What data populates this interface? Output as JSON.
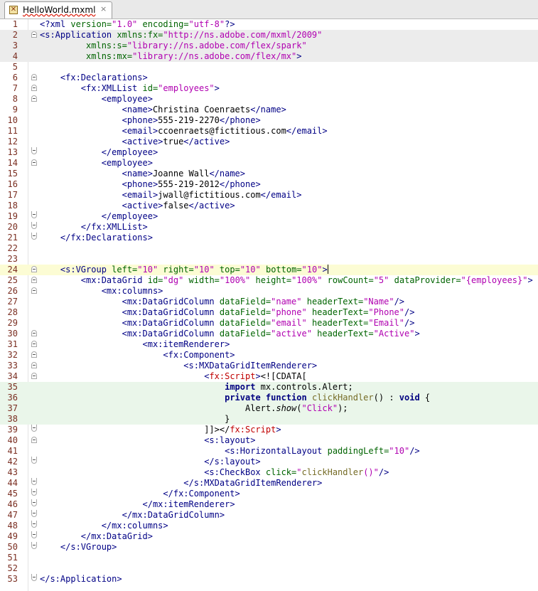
{
  "tab": {
    "label": "HelloWorld.mxml",
    "close": "×",
    "icon": "mxml-file-icon"
  },
  "lines": [
    {
      "n": "1",
      "bg": "",
      "fold": "",
      "segs": [
        [
          "t",
          "<?xml "
        ],
        [
          "a",
          "version="
        ],
        [
          "s",
          "\"1.0\""
        ],
        [
          "t",
          " "
        ],
        [
          "a",
          "encoding="
        ],
        [
          "s",
          "\"utf-8\""
        ],
        [
          "t",
          "?>"
        ]
      ]
    },
    {
      "n": "2",
      "bg": "app",
      "fold": "start",
      "segs": [
        [
          "t",
          "<s:Application "
        ],
        [
          "a",
          "xmlns:fx="
        ],
        [
          "s",
          "\"http://ns.adobe.com/mxml/2009\""
        ]
      ]
    },
    {
      "n": "3",
      "bg": "app",
      "fold": "",
      "segs": [
        [
          "",
          "         "
        ],
        [
          "a",
          "xmlns:s="
        ],
        [
          "s",
          "\"library://ns.adobe.com/flex/spark\""
        ]
      ]
    },
    {
      "n": "4",
      "bg": "app",
      "fold": "",
      "segs": [
        [
          "",
          "         "
        ],
        [
          "a",
          "xmlns:mx="
        ],
        [
          "s",
          "\"library://ns.adobe.com/flex/mx\""
        ],
        [
          "t",
          ">"
        ]
      ]
    },
    {
      "n": "5",
      "bg": "",
      "fold": "",
      "segs": []
    },
    {
      "n": "6",
      "bg": "",
      "fold": "start",
      "segs": [
        [
          "",
          "    "
        ],
        [
          "t",
          "<fx:Declarations>"
        ]
      ]
    },
    {
      "n": "7",
      "bg": "",
      "fold": "start",
      "segs": [
        [
          "",
          "        "
        ],
        [
          "t",
          "<fx:XMLList "
        ],
        [
          "a",
          "id="
        ],
        [
          "s",
          "\"employees\""
        ],
        [
          "t",
          ">"
        ]
      ]
    },
    {
      "n": "8",
      "bg": "",
      "fold": "start",
      "segs": [
        [
          "",
          "            "
        ],
        [
          "t",
          "<employee>"
        ]
      ]
    },
    {
      "n": "9",
      "bg": "",
      "fold": "",
      "segs": [
        [
          "",
          "                "
        ],
        [
          "t",
          "<name>"
        ],
        [
          "",
          "Christina Coenraets"
        ],
        [
          "t",
          "</name>"
        ]
      ]
    },
    {
      "n": "10",
      "bg": "",
      "fold": "",
      "segs": [
        [
          "",
          "                "
        ],
        [
          "t",
          "<phone>"
        ],
        [
          "",
          "555-219-2270"
        ],
        [
          "t",
          "</phone>"
        ]
      ]
    },
    {
      "n": "11",
      "bg": "",
      "fold": "",
      "segs": [
        [
          "",
          "                "
        ],
        [
          "t",
          "<email>"
        ],
        [
          "",
          "ccoenraets@fictitious.com"
        ],
        [
          "t",
          "</email>"
        ]
      ]
    },
    {
      "n": "12",
      "bg": "",
      "fold": "",
      "segs": [
        [
          "",
          "                "
        ],
        [
          "t",
          "<active>"
        ],
        [
          "",
          "true"
        ],
        [
          "t",
          "</active>"
        ]
      ]
    },
    {
      "n": "13",
      "bg": "",
      "fold": "end",
      "segs": [
        [
          "",
          "            "
        ],
        [
          "t",
          "</employee>"
        ]
      ]
    },
    {
      "n": "14",
      "bg": "",
      "fold": "start",
      "segs": [
        [
          "",
          "            "
        ],
        [
          "t",
          "<employee>"
        ]
      ]
    },
    {
      "n": "15",
      "bg": "",
      "fold": "",
      "segs": [
        [
          "",
          "                "
        ],
        [
          "t",
          "<name>"
        ],
        [
          "",
          "Joanne Wall"
        ],
        [
          "t",
          "</name>"
        ]
      ]
    },
    {
      "n": "16",
      "bg": "",
      "fold": "",
      "segs": [
        [
          "",
          "                "
        ],
        [
          "t",
          "<phone>"
        ],
        [
          "",
          "555-219-2012"
        ],
        [
          "t",
          "</phone>"
        ]
      ]
    },
    {
      "n": "17",
      "bg": "",
      "fold": "",
      "segs": [
        [
          "",
          "                "
        ],
        [
          "t",
          "<email>"
        ],
        [
          "",
          "jwall@fictitious.com"
        ],
        [
          "t",
          "</email>"
        ]
      ]
    },
    {
      "n": "18",
      "bg": "",
      "fold": "",
      "segs": [
        [
          "",
          "                "
        ],
        [
          "t",
          "<active>"
        ],
        [
          "",
          "false"
        ],
        [
          "t",
          "</active>"
        ]
      ]
    },
    {
      "n": "19",
      "bg": "",
      "fold": "end",
      "segs": [
        [
          "",
          "            "
        ],
        [
          "t",
          "</employee>"
        ]
      ]
    },
    {
      "n": "20",
      "bg": "",
      "fold": "end",
      "segs": [
        [
          "",
          "        "
        ],
        [
          "t",
          "</fx:XMLList>"
        ]
      ]
    },
    {
      "n": "21",
      "bg": "",
      "fold": "end",
      "segs": [
        [
          "",
          "    "
        ],
        [
          "t",
          "</fx:Declarations>"
        ]
      ]
    },
    {
      "n": "22",
      "bg": "",
      "fold": "",
      "segs": []
    },
    {
      "n": "23",
      "bg": "",
      "fold": "",
      "segs": []
    },
    {
      "n": "24",
      "bg": "cur",
      "fold": "start",
      "segs": [
        [
          "",
          "    "
        ],
        [
          "t",
          "<s:VGroup "
        ],
        [
          "a",
          "left="
        ],
        [
          "s",
          "\"10\""
        ],
        [
          "t",
          " "
        ],
        [
          "a",
          "right="
        ],
        [
          "s",
          "\"10\""
        ],
        [
          "t",
          " "
        ],
        [
          "a",
          "top="
        ],
        [
          "s",
          "\"10\""
        ],
        [
          "t",
          " "
        ],
        [
          "a",
          "bottom="
        ],
        [
          "s",
          "\"10\""
        ],
        [
          "t",
          ">"
        ],
        [
          "caret",
          ""
        ]
      ]
    },
    {
      "n": "25",
      "bg": "",
      "fold": "start",
      "segs": [
        [
          "",
          "        "
        ],
        [
          "t",
          "<mx:DataGrid "
        ],
        [
          "a",
          "id="
        ],
        [
          "s",
          "\"dg\""
        ],
        [
          "t",
          " "
        ],
        [
          "a",
          "width="
        ],
        [
          "s",
          "\"100%\""
        ],
        [
          "t",
          " "
        ],
        [
          "a",
          "height="
        ],
        [
          "s",
          "\"100%\""
        ],
        [
          "t",
          " "
        ],
        [
          "a",
          "rowCount="
        ],
        [
          "s",
          "\"5\""
        ],
        [
          "t",
          " "
        ],
        [
          "a",
          "dataProvider="
        ],
        [
          "s",
          "\"{employees}\""
        ],
        [
          "t",
          ">"
        ]
      ]
    },
    {
      "n": "26",
      "bg": "",
      "fold": "start",
      "segs": [
        [
          "",
          "            "
        ],
        [
          "t",
          "<mx:columns>"
        ]
      ]
    },
    {
      "n": "27",
      "bg": "",
      "fold": "",
      "segs": [
        [
          "",
          "                "
        ],
        [
          "t",
          "<mx:DataGridColumn "
        ],
        [
          "a",
          "dataField="
        ],
        [
          "s",
          "\"name\""
        ],
        [
          "t",
          " "
        ],
        [
          "a",
          "headerText="
        ],
        [
          "s",
          "\"Name\""
        ],
        [
          "t",
          "/>"
        ]
      ]
    },
    {
      "n": "28",
      "bg": "",
      "fold": "",
      "segs": [
        [
          "",
          "                "
        ],
        [
          "t",
          "<mx:DataGridColumn "
        ],
        [
          "a",
          "dataField="
        ],
        [
          "s",
          "\"phone\""
        ],
        [
          "t",
          " "
        ],
        [
          "a",
          "headerText="
        ],
        [
          "s",
          "\"Phone\""
        ],
        [
          "t",
          "/>"
        ]
      ]
    },
    {
      "n": "29",
      "bg": "",
      "fold": "",
      "segs": [
        [
          "",
          "                "
        ],
        [
          "t",
          "<mx:DataGridColumn "
        ],
        [
          "a",
          "dataField="
        ],
        [
          "s",
          "\"email\""
        ],
        [
          "t",
          " "
        ],
        [
          "a",
          "headerText="
        ],
        [
          "s",
          "\"Email\""
        ],
        [
          "t",
          "/>"
        ]
      ]
    },
    {
      "n": "30",
      "bg": "",
      "fold": "start",
      "segs": [
        [
          "",
          "                "
        ],
        [
          "t",
          "<mx:DataGridColumn "
        ],
        [
          "a",
          "dataField="
        ],
        [
          "s",
          "\"active\""
        ],
        [
          "t",
          " "
        ],
        [
          "a",
          "headerText="
        ],
        [
          "s",
          "\"Active\""
        ],
        [
          "t",
          ">"
        ]
      ]
    },
    {
      "n": "31",
      "bg": "",
      "fold": "start",
      "segs": [
        [
          "",
          "                    "
        ],
        [
          "t",
          "<mx:itemRenderer>"
        ]
      ]
    },
    {
      "n": "32",
      "bg": "",
      "fold": "start",
      "segs": [
        [
          "",
          "                        "
        ],
        [
          "t",
          "<fx:Component>"
        ]
      ]
    },
    {
      "n": "33",
      "bg": "",
      "fold": "start",
      "segs": [
        [
          "",
          "                            "
        ],
        [
          "t",
          "<s:MXDataGridItemRenderer>"
        ]
      ]
    },
    {
      "n": "34",
      "bg": "",
      "fold": "start",
      "segs": [
        [
          "",
          "                                "
        ],
        [
          "t",
          "<"
        ],
        [
          "r",
          "fx:Script"
        ],
        [
          "t",
          ">"
        ],
        [
          "",
          "<![CDATA["
        ]
      ]
    },
    {
      "n": "35",
      "bg": "script",
      "fold": "",
      "segs": [
        [
          "",
          "                                    "
        ],
        [
          "k",
          "import"
        ],
        [
          "",
          " mx.controls.Alert;"
        ]
      ]
    },
    {
      "n": "36",
      "bg": "script",
      "fold": "",
      "segs": [
        [
          "",
          "                                    "
        ],
        [
          "k",
          "private"
        ],
        [
          "",
          " "
        ],
        [
          "k",
          "function"
        ],
        [
          "",
          " "
        ],
        [
          "m",
          "clickHandler"
        ],
        [
          "",
          "() : "
        ],
        [
          "k",
          "void"
        ],
        [
          "",
          " {"
        ]
      ]
    },
    {
      "n": "37",
      "bg": "script",
      "fold": "",
      "segs": [
        [
          "",
          "                                        Alert."
        ],
        [
          "i",
          "show"
        ],
        [
          "",
          "("
        ],
        [
          "s",
          "\"Click\""
        ],
        [
          "",
          ");"
        ]
      ]
    },
    {
      "n": "38",
      "bg": "script",
      "fold": "",
      "segs": [
        [
          "",
          "                                    }"
        ]
      ]
    },
    {
      "n": "39",
      "bg": "",
      "fold": "end",
      "segs": [
        [
          "",
          "                                ]]></"
        ],
        [
          "r",
          "fx:Script"
        ],
        [
          "t",
          ">"
        ]
      ]
    },
    {
      "n": "40",
      "bg": "",
      "fold": "start",
      "segs": [
        [
          "",
          "                                "
        ],
        [
          "t",
          "<s:layout>"
        ]
      ]
    },
    {
      "n": "41",
      "bg": "",
      "fold": "",
      "segs": [
        [
          "",
          "                                    "
        ],
        [
          "t",
          "<s:HorizontalLayout "
        ],
        [
          "a",
          "paddingLeft="
        ],
        [
          "s",
          "\"10\""
        ],
        [
          "t",
          "/>"
        ]
      ]
    },
    {
      "n": "42",
      "bg": "",
      "fold": "end",
      "segs": [
        [
          "",
          "                                "
        ],
        [
          "t",
          "</s:layout>"
        ]
      ]
    },
    {
      "n": "43",
      "bg": "",
      "fold": "",
      "segs": [
        [
          "",
          "                                "
        ],
        [
          "t",
          "<s:CheckBox "
        ],
        [
          "a",
          "click="
        ],
        [
          "s",
          "\""
        ],
        [
          "m",
          "clickHandler"
        ],
        [
          "s",
          "()\""
        ],
        [
          "t",
          "/>"
        ]
      ]
    },
    {
      "n": "44",
      "bg": "",
      "fold": "end",
      "segs": [
        [
          "",
          "                            "
        ],
        [
          "t",
          "</s:MXDataGridItemRenderer>"
        ]
      ]
    },
    {
      "n": "45",
      "bg": "",
      "fold": "end",
      "segs": [
        [
          "",
          "                        "
        ],
        [
          "t",
          "</fx:Component>"
        ]
      ]
    },
    {
      "n": "46",
      "bg": "",
      "fold": "end",
      "segs": [
        [
          "",
          "                    "
        ],
        [
          "t",
          "</mx:itemRenderer>"
        ]
      ]
    },
    {
      "n": "47",
      "bg": "",
      "fold": "end",
      "segs": [
        [
          "",
          "                "
        ],
        [
          "t",
          "</mx:DataGridColumn>"
        ]
      ]
    },
    {
      "n": "48",
      "bg": "",
      "fold": "end",
      "segs": [
        [
          "",
          "            "
        ],
        [
          "t",
          "</mx:columns>"
        ]
      ]
    },
    {
      "n": "49",
      "bg": "",
      "fold": "end",
      "segs": [
        [
          "",
          "        "
        ],
        [
          "t",
          "</mx:DataGrid>"
        ]
      ]
    },
    {
      "n": "50",
      "bg": "",
      "fold": "end",
      "segs": [
        [
          "",
          "    "
        ],
        [
          "t",
          "</s:VGroup>"
        ]
      ]
    },
    {
      "n": "51",
      "bg": "",
      "fold": "",
      "segs": []
    },
    {
      "n": "52",
      "bg": "",
      "fold": "",
      "segs": []
    },
    {
      "n": "53",
      "bg": "",
      "fold": "end",
      "segs": [
        [
          "t",
          "</s:Application>"
        ]
      ]
    }
  ]
}
